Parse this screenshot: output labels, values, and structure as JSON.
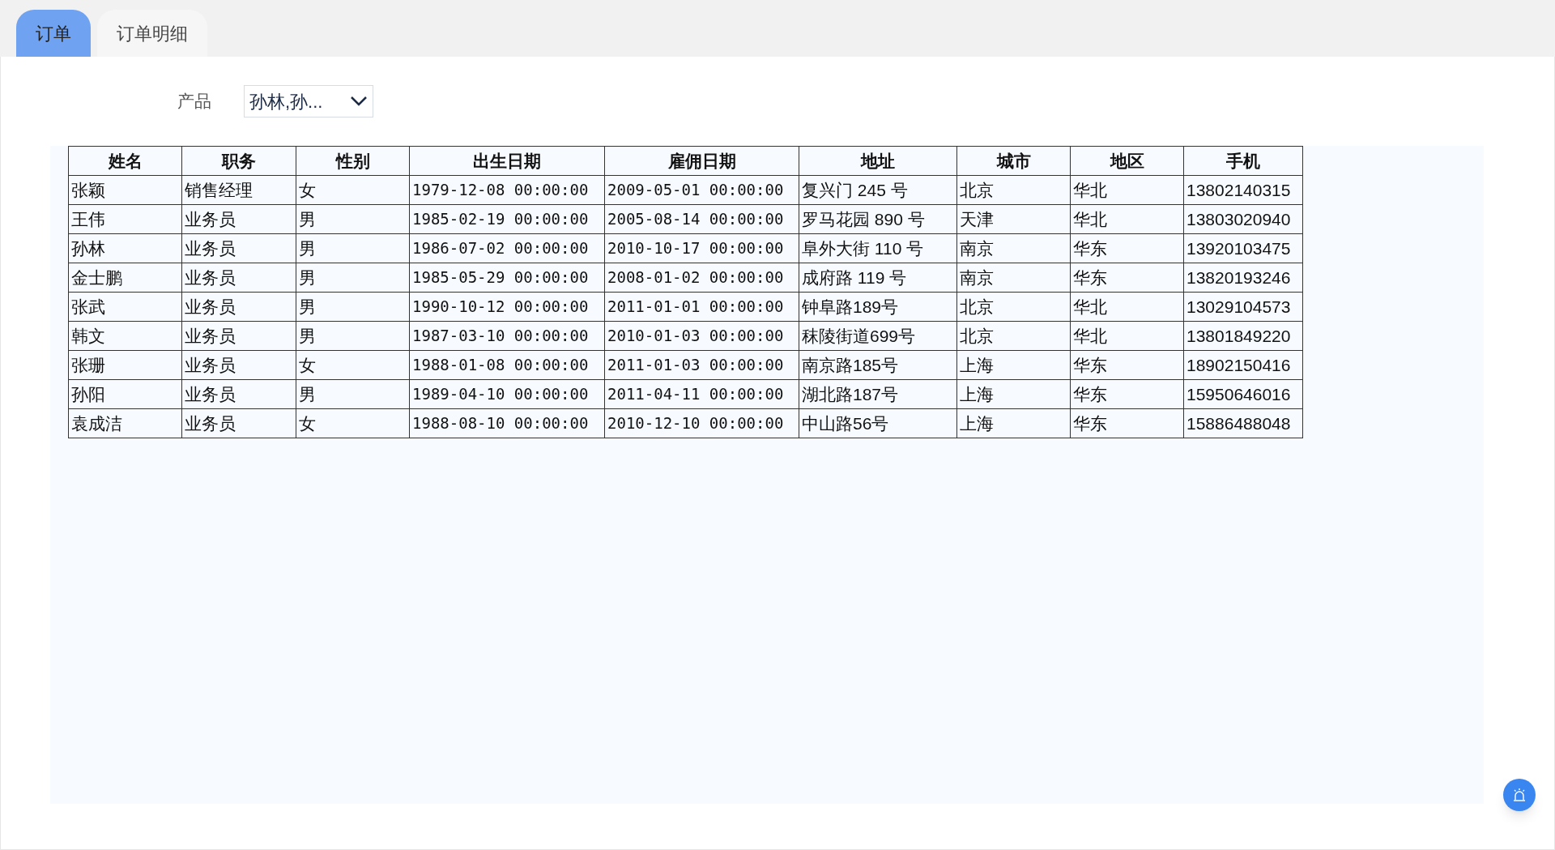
{
  "tabs": [
    {
      "label": "订单",
      "selected": true
    },
    {
      "label": "订单明细",
      "selected": false
    }
  ],
  "filter": {
    "label": "产品",
    "value": "孙林,孙..."
  },
  "table": {
    "columns": [
      "姓名",
      "职务",
      "性别",
      "出生日期",
      "雇佣日期",
      "地址",
      "城市",
      "地区",
      "手机"
    ],
    "rows": [
      [
        "张颖",
        "销售经理",
        "女",
        "1979-12-08 00:00:00",
        "2009-05-01 00:00:00",
        "复兴门 245 号",
        "北京",
        "华北",
        "13802140315"
      ],
      [
        "王伟",
        "业务员",
        "男",
        "1985-02-19 00:00:00",
        "2005-08-14 00:00:00",
        "罗马花园 890 号",
        "天津",
        "华北",
        "13803020940"
      ],
      [
        "孙林",
        "业务员",
        "男",
        "1986-07-02 00:00:00",
        "2010-10-17 00:00:00",
        "阜外大街 110 号",
        "南京",
        "华东",
        "13920103475"
      ],
      [
        "金士鹏",
        "业务员",
        "男",
        "1985-05-29 00:00:00",
        "2008-01-02 00:00:00",
        "成府路 119 号",
        "南京",
        "华东",
        "13820193246"
      ],
      [
        "张武",
        "业务员",
        "男",
        "1990-10-12 00:00:00",
        "2011-01-01 00:00:00",
        "钟阜路189号",
        "北京",
        "华北",
        "13029104573"
      ],
      [
        "韩文",
        "业务员",
        "男",
        "1987-03-10 00:00:00",
        "2010-01-03 00:00:00",
        "秣陵街道699号",
        "北京",
        "华北",
        "13801849220"
      ],
      [
        "张珊",
        "业务员",
        "女",
        "1988-01-08 00:00:00",
        "2011-01-03 00:00:00",
        "南京路185号",
        "上海",
        "华东",
        "18902150416"
      ],
      [
        "孙阳",
        "业务员",
        "男",
        "1989-04-10 00:00:00",
        "2011-04-11 00:00:00",
        "湖北路187号",
        "上海",
        "华东",
        "15950646016"
      ],
      [
        "袁成洁",
        "业务员",
        "女",
        "1988-08-10 00:00:00",
        "2010-12-10 00:00:00",
        "中山路56号",
        "上海",
        "华东",
        "15886488048"
      ]
    ]
  }
}
